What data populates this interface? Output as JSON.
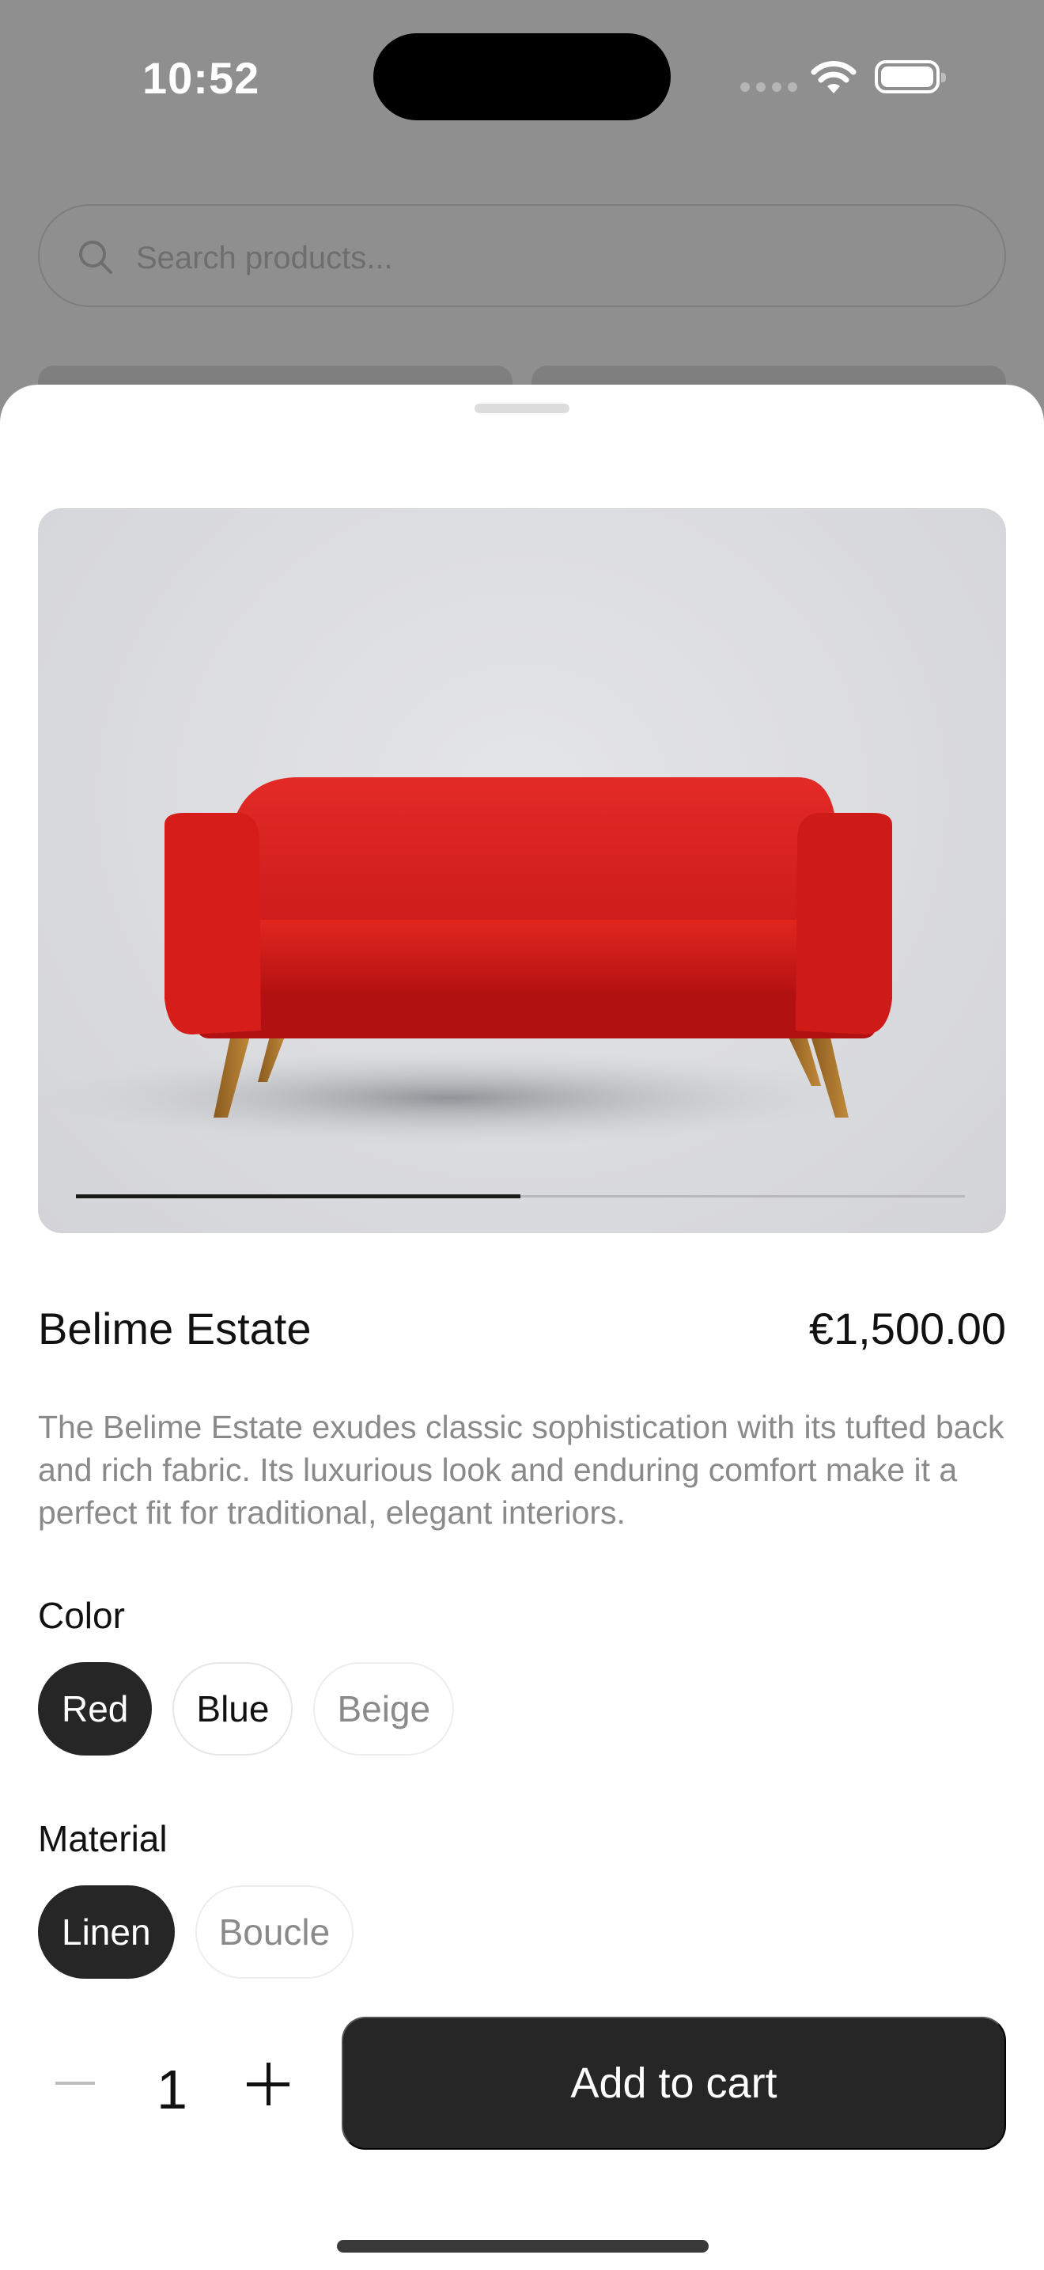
{
  "status_bar": {
    "time": "10:52"
  },
  "search": {
    "placeholder": "Search products..."
  },
  "product": {
    "name": "Belime Estate",
    "price": "€1,500.00",
    "description": "The Belime Estate exudes classic sophistication with its tufted back and rich fabric. Its luxurious look and enduring comfort make it a perfect fit for traditional, elegant interiors.",
    "image_progress": 0.5
  },
  "options": {
    "color": {
      "label": "Color",
      "choices": [
        {
          "label": "Red",
          "state": "selected"
        },
        {
          "label": "Blue",
          "state": "available"
        },
        {
          "label": "Beige",
          "state": "disabled"
        }
      ]
    },
    "material": {
      "label": "Material",
      "choices": [
        {
          "label": "Linen",
          "state": "selected"
        },
        {
          "label": "Boucle",
          "state": "disabled"
        }
      ]
    }
  },
  "quantity": {
    "value": "1"
  },
  "cart": {
    "add_label": "Add to cart"
  },
  "colors": {
    "primary_dark": "#262626",
    "sofa_red": "#d81f1f"
  }
}
